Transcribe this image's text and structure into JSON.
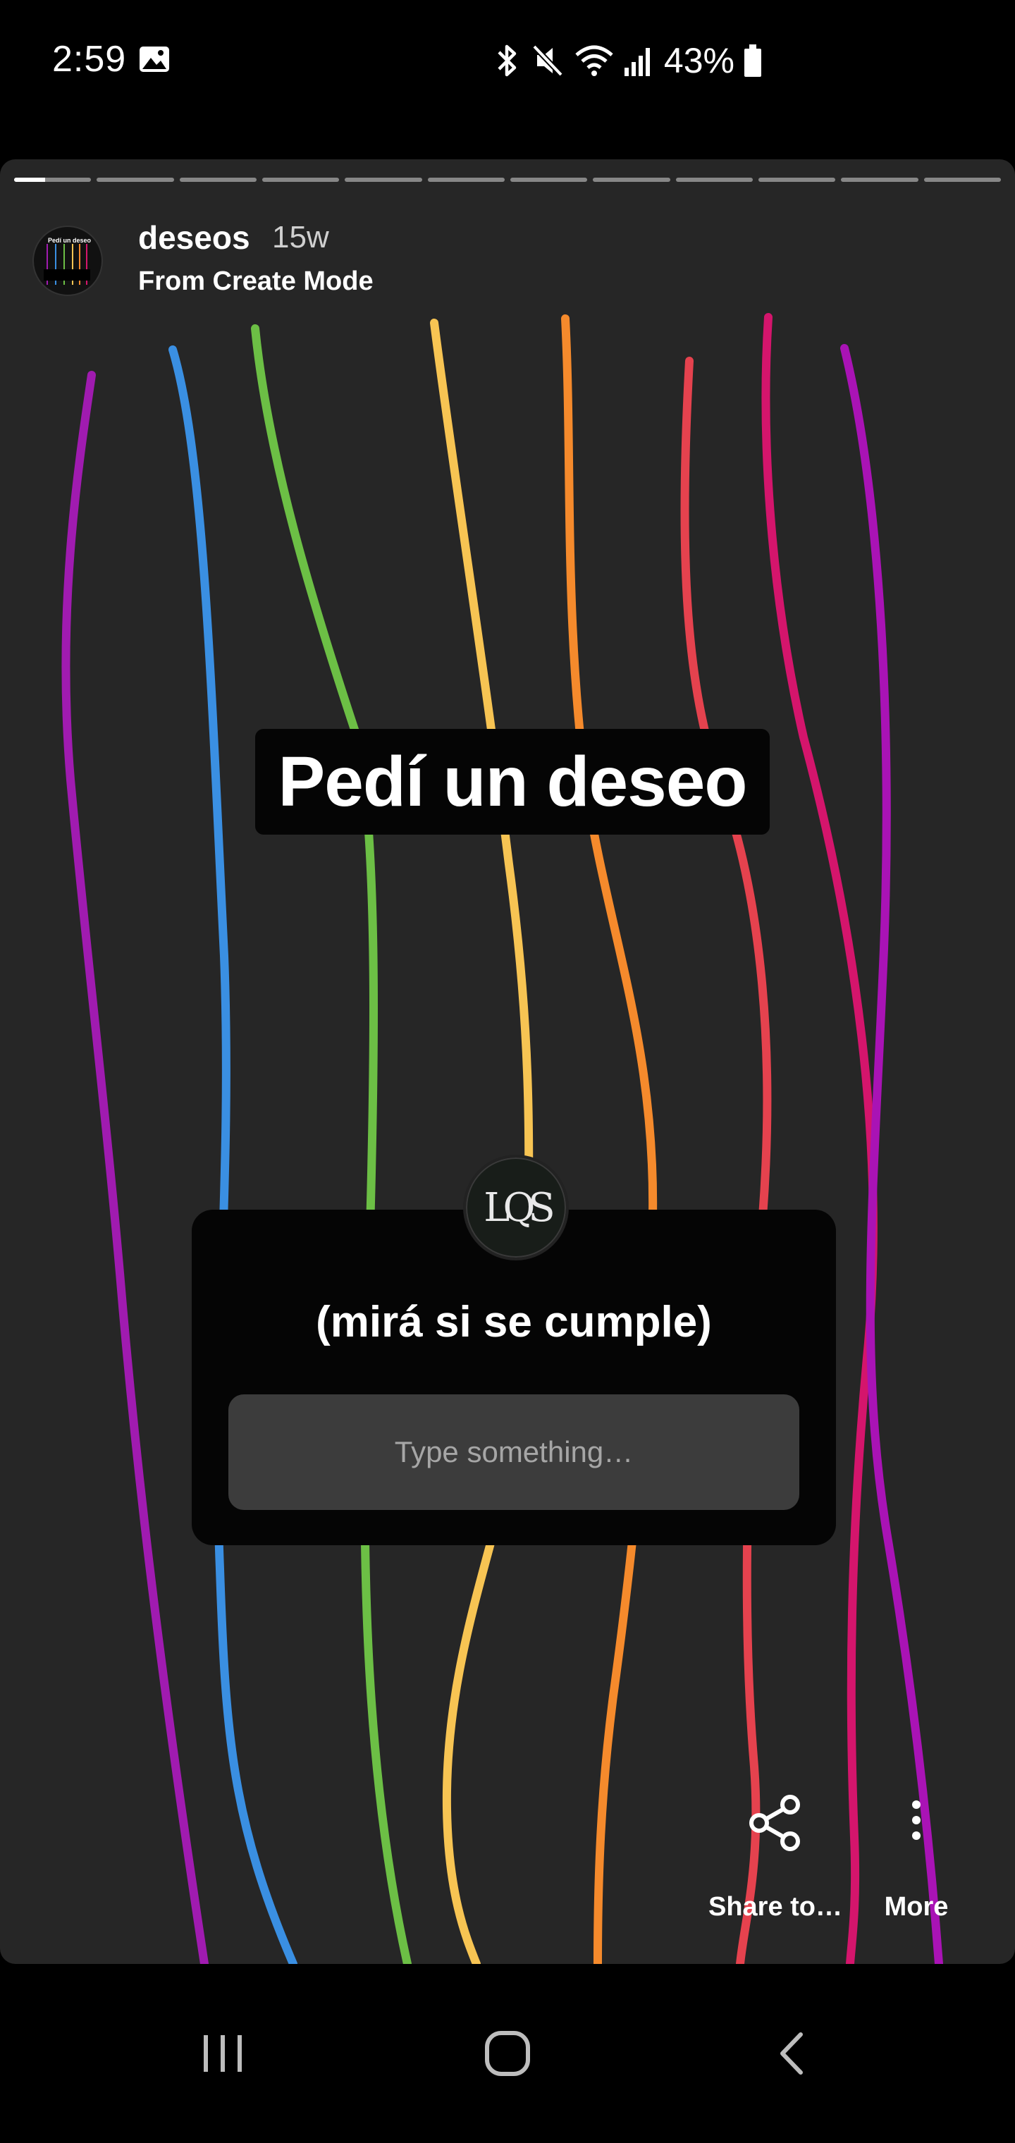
{
  "status_bar": {
    "time": "2:59",
    "battery_percent": "43%",
    "icons": [
      "gallery-icon",
      "bluetooth-icon",
      "mute-icon",
      "wifi-icon",
      "signal-icon",
      "battery-icon"
    ]
  },
  "story": {
    "progress": {
      "total_segments": 12,
      "current_segment": 1,
      "current_fill": 0.4
    },
    "header": {
      "username": "deseos",
      "time_ago": "15w",
      "subtitle": "From Create Mode"
    },
    "headline": "Pedí un deseo",
    "question_card": {
      "avatar_text": "LQS",
      "question": "(mirá si se cumple)",
      "input_placeholder": "Type something…"
    },
    "actions": {
      "share_label": "Share to…",
      "more_label": "More"
    },
    "string_colors": [
      "#a01bb0",
      "#3a8fe2",
      "#6cbf45",
      "#f7c453",
      "#f58a2c",
      "#e5424e",
      "#d4156c",
      "#a913b5"
    ],
    "background_color": "#262626"
  },
  "nav_bar": {
    "icons": [
      "recents-icon",
      "home-icon",
      "back-icon"
    ]
  }
}
